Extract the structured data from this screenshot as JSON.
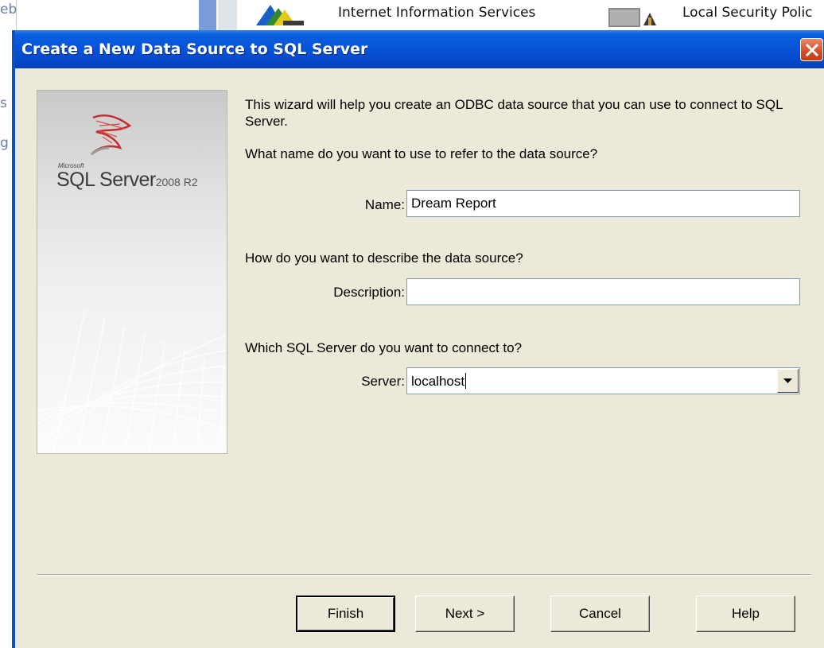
{
  "background": {
    "left_fragments": [
      "eb",
      "s",
      "g"
    ],
    "items": [
      {
        "label": "Internet Information Services",
        "icon": "iis-icon"
      },
      {
        "label": "Local Security Polic",
        "icon": "local-security-policy-icon"
      }
    ]
  },
  "dialog": {
    "title": "Create a New Data Source to SQL Server",
    "close_icon": "close-icon",
    "side_panel": {
      "logo_brand": "Microsoft",
      "logo_product": "SQL Server",
      "logo_version": "2008 R2"
    },
    "intro": "This wizard will help you create an ODBC data source that you can use to connect to SQL Server.",
    "name_question": "What name do you want to use to refer to the data source?",
    "name_label": "Name:",
    "name_value": "Dream Report",
    "description_question": "How do you want to describe the data source?",
    "description_label": "Description:",
    "description_value": "",
    "server_question": "Which SQL Server do you want to connect to?",
    "server_label": "Server:",
    "server_value": "localhost",
    "buttons": {
      "finish": "Finish",
      "next": "Next >",
      "cancel": "Cancel",
      "help": "Help"
    }
  }
}
